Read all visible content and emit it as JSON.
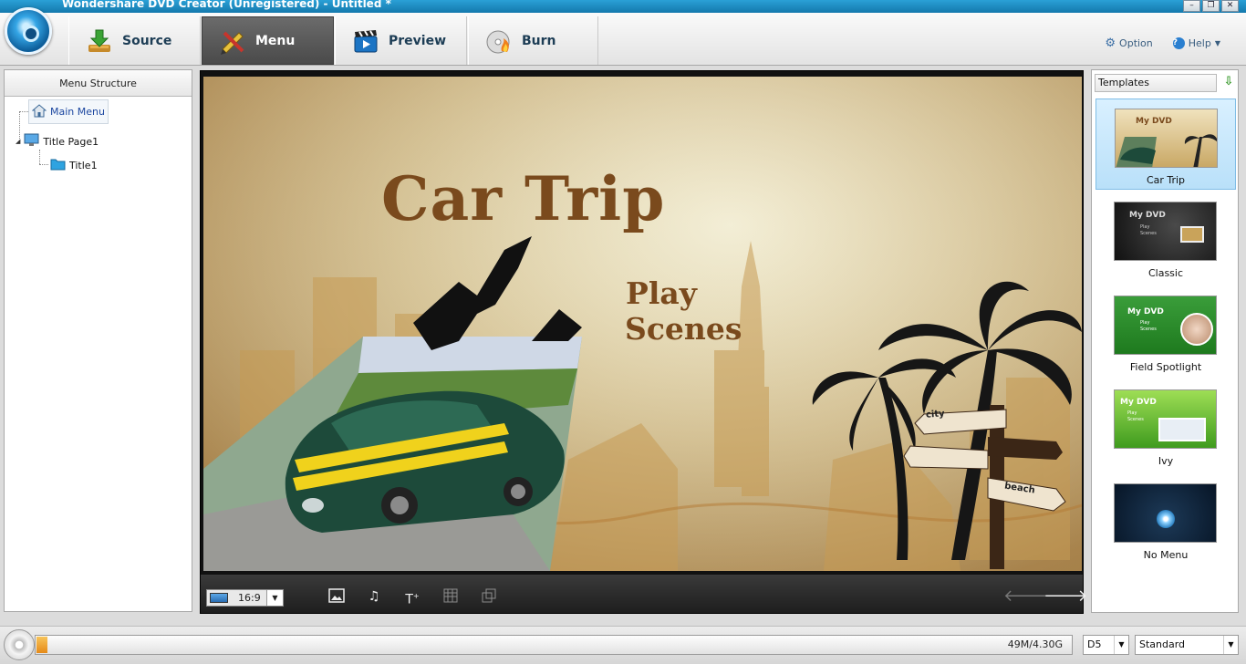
{
  "window": {
    "title": "Wondershare DVD Creator (Unregistered) - Untitled *"
  },
  "toolbar": {
    "tabs": [
      {
        "label": "Source",
        "icon": "download-icon"
      },
      {
        "label": "Menu",
        "icon": "pencil-ruler-icon",
        "active": true
      },
      {
        "label": "Preview",
        "icon": "clapperboard-icon"
      },
      {
        "label": "Burn",
        "icon": "disc-fire-icon"
      }
    ],
    "option_label": "Option",
    "help_label": "Help"
  },
  "menu_structure": {
    "header": "Menu Structure",
    "main_menu": "Main Menu",
    "title_page": "Title Page1",
    "title_item": "Title1"
  },
  "preview": {
    "title": "Car Trip",
    "play_label": "Play",
    "scenes_label": "Scenes",
    "sign_city": "city",
    "sign_beach": "beach",
    "aspect_ratio": "16:9"
  },
  "templates": {
    "header": "Templates",
    "items": [
      {
        "name": "Car Trip",
        "thumb_title": "My DVD",
        "selected": true
      },
      {
        "name": "Classic",
        "thumb_title": "My DVD",
        "thumb_line1": "Play",
        "thumb_line2": "Scenes"
      },
      {
        "name": "Field Spotlight",
        "thumb_title": "My DVD",
        "thumb_line1": "Play",
        "thumb_line2": "Scenes"
      },
      {
        "name": "Ivy",
        "thumb_title": "My DVD",
        "thumb_line1": "Play",
        "thumb_line2": "Scenes"
      },
      {
        "name": "No Menu"
      }
    ]
  },
  "status": {
    "capacity": "49M/4.30G",
    "used_fraction": 0.011,
    "disc_type": "D5",
    "quality": "Standard"
  },
  "colors": {
    "title_brown": "#7a4a1d",
    "accent_blue": "#1b8fcf"
  }
}
